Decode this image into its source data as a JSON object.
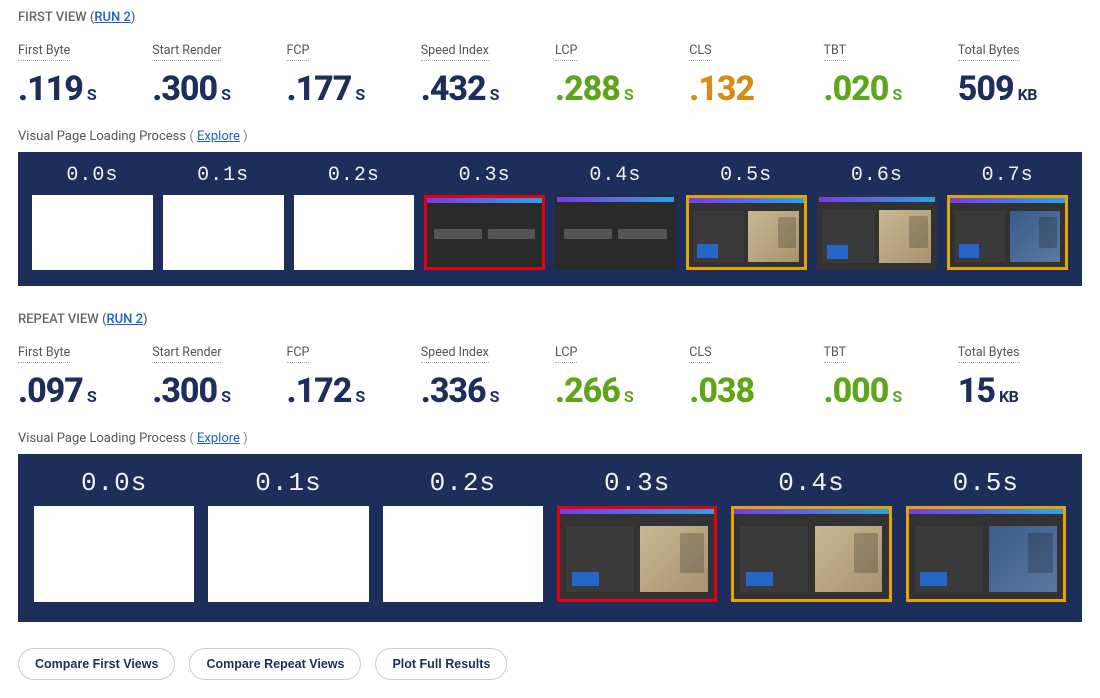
{
  "first_view": {
    "title_prefix": "FIRST VIEW",
    "run_label": "RUN 2",
    "metrics": [
      {
        "label": "First Byte",
        "value": ".119",
        "unit": "S",
        "color": ""
      },
      {
        "label": "Start Render",
        "value": ".300",
        "unit": "S",
        "color": ""
      },
      {
        "label": "FCP",
        "value": ".177",
        "unit": "S",
        "color": ""
      },
      {
        "label": "Speed Index",
        "value": ".432",
        "unit": "S",
        "color": ""
      },
      {
        "label": "LCP",
        "value": ".288",
        "unit": "S",
        "color": "green"
      },
      {
        "label": "CLS",
        "value": ".132",
        "unit": "",
        "color": "orange"
      },
      {
        "label": "TBT",
        "value": ".020",
        "unit": "S",
        "color": "green"
      },
      {
        "label": "Total Bytes",
        "value": "509",
        "unit": "KB",
        "color": ""
      }
    ],
    "visual_label": "Visual Page Loading Process",
    "explore_label": "Explore",
    "frames": [
      {
        "time": "0.0s",
        "type": "blank"
      },
      {
        "time": "0.1s",
        "type": "blank"
      },
      {
        "time": "0.2s",
        "type": "blank"
      },
      {
        "time": "0.3s",
        "type": "dark",
        "border": "red"
      },
      {
        "time": "0.4s",
        "type": "dark",
        "border": ""
      },
      {
        "time": "0.5s",
        "type": "light",
        "border": "orange",
        "variant": "beige"
      },
      {
        "time": "0.6s",
        "type": "light",
        "border": "",
        "variant": "beige"
      },
      {
        "time": "0.7s",
        "type": "light",
        "border": "orange",
        "variant": "blue"
      }
    ]
  },
  "repeat_view": {
    "title_prefix": "REPEAT VIEW",
    "run_label": "RUN 2",
    "metrics": [
      {
        "label": "First Byte",
        "value": ".097",
        "unit": "S",
        "color": ""
      },
      {
        "label": "Start Render",
        "value": ".300",
        "unit": "S",
        "color": ""
      },
      {
        "label": "FCP",
        "value": ".172",
        "unit": "S",
        "color": ""
      },
      {
        "label": "Speed Index",
        "value": ".336",
        "unit": "S",
        "color": ""
      },
      {
        "label": "LCP",
        "value": ".266",
        "unit": "S",
        "color": "green"
      },
      {
        "label": "CLS",
        "value": ".038",
        "unit": "",
        "color": "green"
      },
      {
        "label": "TBT",
        "value": ".000",
        "unit": "S",
        "color": "green"
      },
      {
        "label": "Total Bytes",
        "value": "15",
        "unit": "KB",
        "color": ""
      }
    ],
    "visual_label": "Visual Page Loading Process",
    "explore_label": "Explore",
    "frames": [
      {
        "time": "0.0s",
        "type": "blank"
      },
      {
        "time": "0.1s",
        "type": "blank"
      },
      {
        "time": "0.2s",
        "type": "blank"
      },
      {
        "time": "0.3s",
        "type": "light",
        "border": "red",
        "variant": "beige"
      },
      {
        "time": "0.4s",
        "type": "light",
        "border": "orange",
        "variant": "beige"
      },
      {
        "time": "0.5s",
        "type": "light",
        "border": "orange",
        "variant": "blue"
      }
    ]
  },
  "buttons": {
    "compare_first": "Compare First Views",
    "compare_repeat": "Compare Repeat Views",
    "plot_full": "Plot Full Results"
  }
}
